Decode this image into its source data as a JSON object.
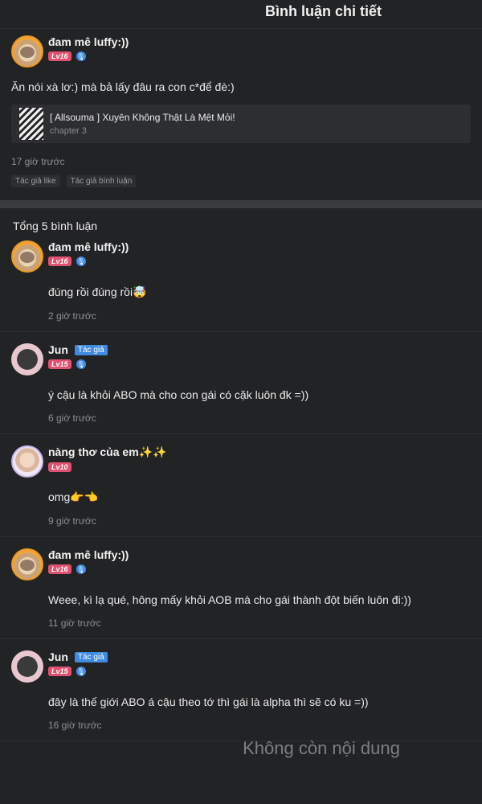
{
  "header": {
    "title": "Bình luận chi tiết"
  },
  "main_post": {
    "username": "đam mê luffy:))",
    "level": "Lv16",
    "text": "Ăn nói xà lơ:) mà bả lấy đâu ra con c*để đè:)",
    "chapter": {
      "title": "[ Allsouma ] Xuyên Không Thật Là Mệt Mỏi!",
      "subtitle": "chapter 3"
    },
    "time": "17 giờ trước",
    "tags": [
      "Tác giả like",
      "Tác giả bình luận"
    ]
  },
  "total_label": "Tổng 5 bình luận",
  "comments": [
    {
      "username": "đam mê luffy:))",
      "level": "Lv16",
      "author_tag": "",
      "text": "đúng rồi đúng rồi🤯",
      "time": "2 giờ trước"
    },
    {
      "username": "Jun",
      "level": "Lv15",
      "author_tag": "Tác giả",
      "text": "ý cậu là khỏi ABO mà cho con gái có cặk luôn đk =))",
      "time": "6 giờ trước"
    },
    {
      "username": "nàng thơ của em✨✨",
      "level": "Lv10",
      "author_tag": "",
      "text": "omg👉👈",
      "time": "9 giờ trước"
    },
    {
      "username": "đam mê luffy:))",
      "level": "Lv16",
      "author_tag": "",
      "text": "Weee, kì lạ qué, hông mấy khỏi AOB mà cho gái thành đột biến luôn đi:))",
      "time": "11 giờ trước"
    },
    {
      "username": "Jun",
      "level": "Lv15",
      "author_tag": "Tác giả",
      "text": "đây là thế giới ABO á cậu theo tớ thì gái là alpha thì sẽ có ku =))",
      "time": "16 giờ trước"
    }
  ],
  "end_text": "Không còn nội dung",
  "icons": {
    "mic": "microphone-icon"
  },
  "colors": {
    "level_badge": "#e0506f",
    "author_badge": "#3f8be0",
    "background": "#222325"
  }
}
